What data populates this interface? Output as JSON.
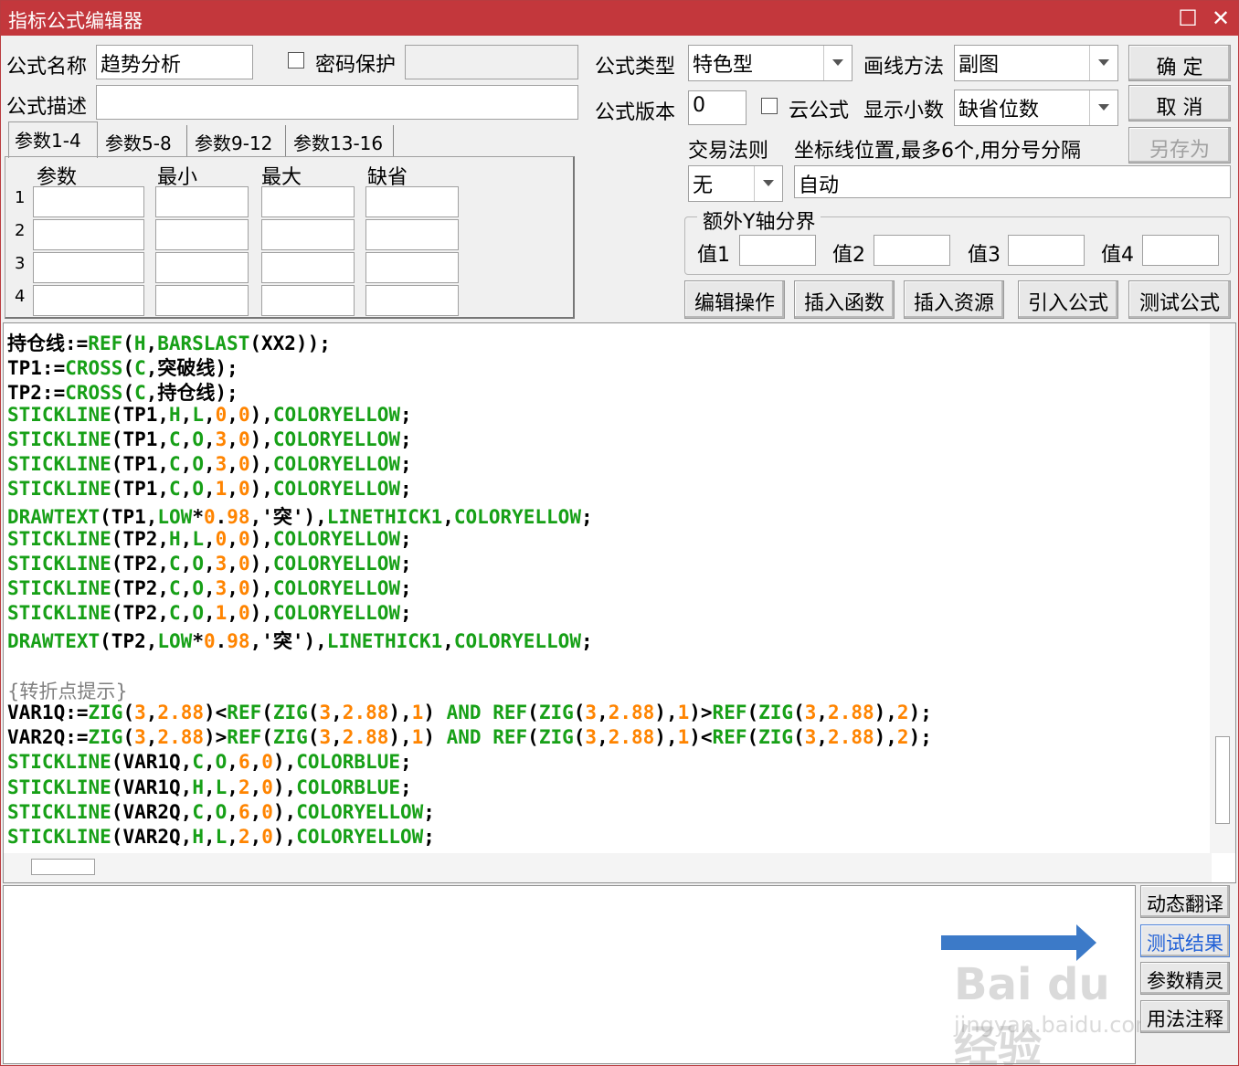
{
  "window": {
    "title": "指标公式编辑器"
  },
  "form": {
    "name_label": "公式名称",
    "name_value": "趋势分析",
    "password_label": "密码保护",
    "desc_label": "公式描述",
    "type_label": "公式类型",
    "type_value": "特色型",
    "draw_label": "画线方法",
    "draw_value": "副图",
    "version_label": "公式版本",
    "version_value": "0",
    "cloud_label": "云公式",
    "decimals_label": "显示小数",
    "decimals_value": "缺省位数",
    "trade_label": "交易法则",
    "trade_value": "无",
    "axis_label": "坐标线位置,最多6个,用分号分隔",
    "axis_value": "自动",
    "yaxis_group_label": "额外Y轴分界",
    "y1": "值1",
    "y2": "值2",
    "y3": "值3",
    "y4": "值4"
  },
  "buttons": {
    "ok": "确  定",
    "cancel": "取  消",
    "save_as": "另存为",
    "edit_ops": "编辑操作",
    "insert_func": "插入函数",
    "insert_res": "插入资源",
    "import_formula": "引入公式",
    "test_formula": "测试公式",
    "dynamic_translate": "动态翻译",
    "test_result": "测试结果",
    "param_wizard": "参数精灵",
    "usage_notes": "用法注释"
  },
  "tabs": [
    "参数1-4",
    "参数5-8",
    "参数9-12",
    "参数13-16"
  ],
  "params": {
    "headers": [
      "参数",
      "最小",
      "最大",
      "缺省"
    ],
    "rows": [
      "1",
      "2",
      "3",
      "4"
    ]
  },
  "code_lines": [
    [
      [
        "k",
        "持仓线:="
      ],
      [
        "f",
        "REF"
      ],
      [
        "p",
        "("
      ],
      [
        "f",
        "H"
      ],
      [
        "p",
        ","
      ],
      [
        "f",
        "BARSLAST"
      ],
      [
        "p",
        "(XX2));"
      ]
    ],
    [
      [
        "k",
        "TP1:="
      ],
      [
        "f",
        "CROSS"
      ],
      [
        "p",
        "("
      ],
      [
        "f",
        "C"
      ],
      [
        "p",
        ",突破线);"
      ]
    ],
    [
      [
        "k",
        "TP2:="
      ],
      [
        "f",
        "CROSS"
      ],
      [
        "p",
        "("
      ],
      [
        "f",
        "C"
      ],
      [
        "p",
        ",持仓线);"
      ]
    ],
    [
      [
        "f",
        "STICKLINE"
      ],
      [
        "p",
        "(TP1,"
      ],
      [
        "f",
        "H"
      ],
      [
        "p",
        ","
      ],
      [
        "f",
        "L"
      ],
      [
        "p",
        ","
      ],
      [
        "n",
        "0"
      ],
      [
        "p",
        ","
      ],
      [
        "n",
        "0"
      ],
      [
        "p",
        "),"
      ],
      [
        "f",
        "COLORYELLOW"
      ],
      [
        "p",
        ";"
      ]
    ],
    [
      [
        "f",
        "STICKLINE"
      ],
      [
        "p",
        "(TP1,"
      ],
      [
        "f",
        "C"
      ],
      [
        "p",
        ","
      ],
      [
        "f",
        "O"
      ],
      [
        "p",
        ","
      ],
      [
        "n",
        "3"
      ],
      [
        "p",
        ","
      ],
      [
        "n",
        "0"
      ],
      [
        "p",
        "),"
      ],
      [
        "f",
        "COLORYELLOW"
      ],
      [
        "p",
        ";"
      ]
    ],
    [
      [
        "f",
        "STICKLINE"
      ],
      [
        "p",
        "(TP1,"
      ],
      [
        "f",
        "C"
      ],
      [
        "p",
        ","
      ],
      [
        "f",
        "O"
      ],
      [
        "p",
        ","
      ],
      [
        "n",
        "3"
      ],
      [
        "p",
        ","
      ],
      [
        "n",
        "0"
      ],
      [
        "p",
        "),"
      ],
      [
        "f",
        "COLORYELLOW"
      ],
      [
        "p",
        ";"
      ]
    ],
    [
      [
        "f",
        "STICKLINE"
      ],
      [
        "p",
        "(TP1,"
      ],
      [
        "f",
        "C"
      ],
      [
        "p",
        ","
      ],
      [
        "f",
        "O"
      ],
      [
        "p",
        ","
      ],
      [
        "n",
        "1"
      ],
      [
        "p",
        ","
      ],
      [
        "n",
        "0"
      ],
      [
        "p",
        "),"
      ],
      [
        "f",
        "COLORYELLOW"
      ],
      [
        "p",
        ";"
      ]
    ],
    [
      [
        "f",
        "DRAWTEXT"
      ],
      [
        "p",
        "(TP1,"
      ],
      [
        "f",
        "LOW"
      ],
      [
        "p",
        "*"
      ],
      [
        "n",
        "0"
      ],
      [
        "p",
        "."
      ],
      [
        "n",
        "98"
      ],
      [
        "p",
        ",'突'),"
      ],
      [
        "f",
        "LINETHICK1"
      ],
      [
        "p",
        ","
      ],
      [
        "f",
        "COLORYELLOW"
      ],
      [
        "p",
        ";"
      ]
    ],
    [
      [
        "f",
        "STICKLINE"
      ],
      [
        "p",
        "(TP2,"
      ],
      [
        "f",
        "H"
      ],
      [
        "p",
        ","
      ],
      [
        "f",
        "L"
      ],
      [
        "p",
        ","
      ],
      [
        "n",
        "0"
      ],
      [
        "p",
        ","
      ],
      [
        "n",
        "0"
      ],
      [
        "p",
        "),"
      ],
      [
        "f",
        "COLORYELLOW"
      ],
      [
        "p",
        ";"
      ]
    ],
    [
      [
        "f",
        "STICKLINE"
      ],
      [
        "p",
        "(TP2,"
      ],
      [
        "f",
        "C"
      ],
      [
        "p",
        ","
      ],
      [
        "f",
        "O"
      ],
      [
        "p",
        ","
      ],
      [
        "n",
        "3"
      ],
      [
        "p",
        ","
      ],
      [
        "n",
        "0"
      ],
      [
        "p",
        "),"
      ],
      [
        "f",
        "COLORYELLOW"
      ],
      [
        "p",
        ";"
      ]
    ],
    [
      [
        "f",
        "STICKLINE"
      ],
      [
        "p",
        "(TP2,"
      ],
      [
        "f",
        "C"
      ],
      [
        "p",
        ","
      ],
      [
        "f",
        "O"
      ],
      [
        "p",
        ","
      ],
      [
        "n",
        "3"
      ],
      [
        "p",
        ","
      ],
      [
        "n",
        "0"
      ],
      [
        "p",
        "),"
      ],
      [
        "f",
        "COLORYELLOW"
      ],
      [
        "p",
        ";"
      ]
    ],
    [
      [
        "f",
        "STICKLINE"
      ],
      [
        "p",
        "(TP2,"
      ],
      [
        "f",
        "C"
      ],
      [
        "p",
        ","
      ],
      [
        "f",
        "O"
      ],
      [
        "p",
        ","
      ],
      [
        "n",
        "1"
      ],
      [
        "p",
        ","
      ],
      [
        "n",
        "0"
      ],
      [
        "p",
        "),"
      ],
      [
        "f",
        "COLORYELLOW"
      ],
      [
        "p",
        ";"
      ]
    ],
    [
      [
        "f",
        "DRAWTEXT"
      ],
      [
        "p",
        "(TP2,"
      ],
      [
        "f",
        "LOW"
      ],
      [
        "p",
        "*"
      ],
      [
        "n",
        "0"
      ],
      [
        "p",
        "."
      ],
      [
        "n",
        "98"
      ],
      [
        "p",
        ",'突'),"
      ],
      [
        "f",
        "LINETHICK1"
      ],
      [
        "p",
        ","
      ],
      [
        "f",
        "COLORYELLOW"
      ],
      [
        "p",
        ";"
      ]
    ],
    [],
    [
      [
        "c",
        "{转折点提示}"
      ]
    ],
    [
      [
        "k",
        "VAR1Q:="
      ],
      [
        "f",
        "ZIG"
      ],
      [
        "p",
        "("
      ],
      [
        "n",
        "3"
      ],
      [
        "p",
        ","
      ],
      [
        "n",
        "2.88"
      ],
      [
        "p",
        ")<"
      ],
      [
        "f",
        "REF"
      ],
      [
        "p",
        "("
      ],
      [
        "f",
        "ZIG"
      ],
      [
        "p",
        "("
      ],
      [
        "n",
        "3"
      ],
      [
        "p",
        ","
      ],
      [
        "n",
        "2.88"
      ],
      [
        "p",
        "),"
      ],
      [
        "n",
        "1"
      ],
      [
        "p",
        ") "
      ],
      [
        "f",
        "AND"
      ],
      [
        "p",
        " "
      ],
      [
        "f",
        "REF"
      ],
      [
        "p",
        "("
      ],
      [
        "f",
        "ZIG"
      ],
      [
        "p",
        "("
      ],
      [
        "n",
        "3"
      ],
      [
        "p",
        ","
      ],
      [
        "n",
        "2.88"
      ],
      [
        "p",
        "),"
      ],
      [
        "n",
        "1"
      ],
      [
        "p",
        ")>"
      ],
      [
        "f",
        "REF"
      ],
      [
        "p",
        "("
      ],
      [
        "f",
        "ZIG"
      ],
      [
        "p",
        "("
      ],
      [
        "n",
        "3"
      ],
      [
        "p",
        ","
      ],
      [
        "n",
        "2.88"
      ],
      [
        "p",
        "),"
      ],
      [
        "n",
        "2"
      ],
      [
        "p",
        ");"
      ]
    ],
    [
      [
        "k",
        "VAR2Q:="
      ],
      [
        "f",
        "ZIG"
      ],
      [
        "p",
        "("
      ],
      [
        "n",
        "3"
      ],
      [
        "p",
        ","
      ],
      [
        "n",
        "2.88"
      ],
      [
        "p",
        ")>"
      ],
      [
        "f",
        "REF"
      ],
      [
        "p",
        "("
      ],
      [
        "f",
        "ZIG"
      ],
      [
        "p",
        "("
      ],
      [
        "n",
        "3"
      ],
      [
        "p",
        ","
      ],
      [
        "n",
        "2.88"
      ],
      [
        "p",
        "),"
      ],
      [
        "n",
        "1"
      ],
      [
        "p",
        ") "
      ],
      [
        "f",
        "AND"
      ],
      [
        "p",
        " "
      ],
      [
        "f",
        "REF"
      ],
      [
        "p",
        "("
      ],
      [
        "f",
        "ZIG"
      ],
      [
        "p",
        "("
      ],
      [
        "n",
        "3"
      ],
      [
        "p",
        ","
      ],
      [
        "n",
        "2.88"
      ],
      [
        "p",
        "),"
      ],
      [
        "n",
        "1"
      ],
      [
        "p",
        ")<"
      ],
      [
        "f",
        "REF"
      ],
      [
        "p",
        "("
      ],
      [
        "f",
        "ZIG"
      ],
      [
        "p",
        "("
      ],
      [
        "n",
        "3"
      ],
      [
        "p",
        ","
      ],
      [
        "n",
        "2.88"
      ],
      [
        "p",
        "),"
      ],
      [
        "n",
        "2"
      ],
      [
        "p",
        ");"
      ]
    ],
    [
      [
        "f",
        "STICKLINE"
      ],
      [
        "p",
        "(VAR1Q,"
      ],
      [
        "f",
        "C"
      ],
      [
        "p",
        ","
      ],
      [
        "f",
        "O"
      ],
      [
        "p",
        ","
      ],
      [
        "n",
        "6"
      ],
      [
        "p",
        ","
      ],
      [
        "n",
        "0"
      ],
      [
        "p",
        "),"
      ],
      [
        "f",
        "COLORBLUE"
      ],
      [
        "p",
        ";"
      ]
    ],
    [
      [
        "f",
        "STICKLINE"
      ],
      [
        "p",
        "(VAR1Q,"
      ],
      [
        "f",
        "H"
      ],
      [
        "p",
        ","
      ],
      [
        "f",
        "L"
      ],
      [
        "p",
        ","
      ],
      [
        "n",
        "2"
      ],
      [
        "p",
        ","
      ],
      [
        "n",
        "0"
      ],
      [
        "p",
        "),"
      ],
      [
        "f",
        "COLORBLUE"
      ],
      [
        "p",
        ";"
      ]
    ],
    [
      [
        "f",
        "STICKLINE"
      ],
      [
        "p",
        "(VAR2Q,"
      ],
      [
        "f",
        "C"
      ],
      [
        "p",
        ","
      ],
      [
        "f",
        "O"
      ],
      [
        "p",
        ","
      ],
      [
        "n",
        "6"
      ],
      [
        "p",
        ","
      ],
      [
        "n",
        "0"
      ],
      [
        "p",
        "),"
      ],
      [
        "f",
        "COLORYELLOW"
      ],
      [
        "p",
        ";"
      ]
    ],
    [
      [
        "f",
        "STICKLINE"
      ],
      [
        "p",
        "(VAR2Q,"
      ],
      [
        "f",
        "H"
      ],
      [
        "p",
        ","
      ],
      [
        "f",
        "L"
      ],
      [
        "p",
        ","
      ],
      [
        "n",
        "2"
      ],
      [
        "p",
        ","
      ],
      [
        "n",
        "0"
      ],
      [
        "p",
        "),"
      ],
      [
        "f",
        "COLORYELLOW"
      ],
      [
        "p",
        ";"
      ]
    ]
  ],
  "watermark": {
    "brand": "Bai du 经验",
    "url": "jingyan.baidu.com"
  },
  "colors": {
    "titlebar": "#c3373c",
    "keyword": "#17a017",
    "number": "#ff8400",
    "comment": "#808080",
    "arrow": "#3c7ac8"
  }
}
